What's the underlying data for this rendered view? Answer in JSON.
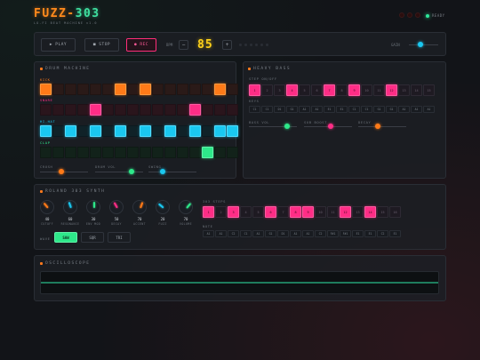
{
  "app": {
    "title_a": "FUZZ-",
    "title_b": "303",
    "subtitle": "LO-FI BEAT MACHINE v1.0",
    "status": "READY"
  },
  "transport": {
    "play_label": "▶ PLAY",
    "stop_label": "■ STOP",
    "rec_label": "● REC",
    "bpm_label": "BPM",
    "bpm_value": "85",
    "minus": "−",
    "plus": "+",
    "gain_label": "GAIN",
    "gain_level": 0.4
  },
  "drum": {
    "title": "DRUM MACHINE",
    "tracks": [
      {
        "name": "KICK",
        "color": "#ff7a18",
        "cls": "kick",
        "steps": [
          1,
          0,
          0,
          0,
          0,
          0,
          1,
          0,
          1,
          0,
          0,
          0,
          0,
          0,
          1,
          0
        ]
      },
      {
        "name": "SNARE",
        "color": "#ff2d86",
        "cls": "snare",
        "steps": [
          0,
          0,
          0,
          0,
          1,
          0,
          0,
          0,
          0,
          0,
          0,
          0,
          1,
          0,
          0,
          0
        ]
      },
      {
        "name": "HI-HAT",
        "color": "#1ac8f0",
        "cls": "hat",
        "steps": [
          1,
          0,
          1,
          0,
          1,
          0,
          1,
          0,
          1,
          0,
          1,
          0,
          1,
          0,
          1,
          1
        ]
      },
      {
        "name": "CLAP",
        "color": "#2ee88a",
        "cls": "clap",
        "steps": [
          0,
          0,
          0,
          0,
          0,
          0,
          0,
          0,
          0,
          0,
          0,
          0,
          0,
          1,
          0,
          0
        ]
      }
    ],
    "sliders": [
      {
        "label": "CRUSH",
        "color": "#ff7a18",
        "value": 0.45
      },
      {
        "label": "DRUM VOL",
        "color": "#2ee88a",
        "value": 0.75
      },
      {
        "label": "SWING",
        "color": "#1ac8f0",
        "value": 0.3
      }
    ]
  },
  "bass": {
    "title": "HEAVY BASS",
    "steps_label": "STEP ON/OFF",
    "steps": [
      1,
      0,
      0,
      1,
      0,
      0,
      1,
      0,
      1,
      0,
      0,
      1,
      0,
      0,
      0
    ],
    "keys_label": "KEYS",
    "keys": [
      "C1",
      "C1",
      "D1",
      "G1",
      "A1",
      "A1",
      "E1",
      "E1",
      "C1",
      "C1",
      "G1",
      "G1",
      "A1",
      "A1",
      "A1"
    ],
    "sliders": [
      {
        "label": "BASS VOL",
        "color": "#2ee88a",
        "value": 0.8
      },
      {
        "label": "SUB BOOST",
        "color": "#ff2d86",
        "value": 0.55
      },
      {
        "label": "DECAY",
        "color": "#ff7a18",
        "value": 0.4
      }
    ]
  },
  "synth": {
    "title": "ROLAND 303 SYNTH",
    "knobs": [
      {
        "value": "40",
        "label": "CUTOFF",
        "color": "#ff7a18",
        "angle": -40
      },
      {
        "value": "60",
        "label": "RESONANCE",
        "color": "#1ac8f0",
        "angle": -20
      },
      {
        "value": "30",
        "label": "ENV MOD",
        "color": "#2ee88a",
        "angle": 0
      },
      {
        "value": "50",
        "label": "DECAY",
        "color": "#ff2d86",
        "angle": -30
      },
      {
        "value": "70",
        "label": "ACCENT",
        "color": "#ff7a18",
        "angle": 20
      },
      {
        "value": "20",
        "label": "FUZZ",
        "color": "#1ac8f0",
        "angle": -50
      },
      {
        "value": "70",
        "label": "VOLUME",
        "color": "#2ee88a",
        "angle": 40
      }
    ],
    "wave_label": "WAVE",
    "waves": [
      "SAW",
      "SQR",
      "TRI"
    ],
    "wave_active": 0,
    "steps_label": "303 STEPS",
    "steps": [
      1,
      0,
      1,
      0,
      0,
      1,
      0,
      1,
      1,
      0,
      0,
      1,
      0,
      1,
      0,
      0
    ],
    "notes_label": "NOTE",
    "notes": [
      "A1",
      "A1",
      "C2",
      "C1",
      "A1",
      "G1",
      "D1",
      "A1",
      "A1",
      "C2",
      "F#1",
      "F#1",
      "E1",
      "E1",
      "C2",
      "E1"
    ]
  },
  "scope": {
    "title": "OSCILLOSCOPE"
  }
}
